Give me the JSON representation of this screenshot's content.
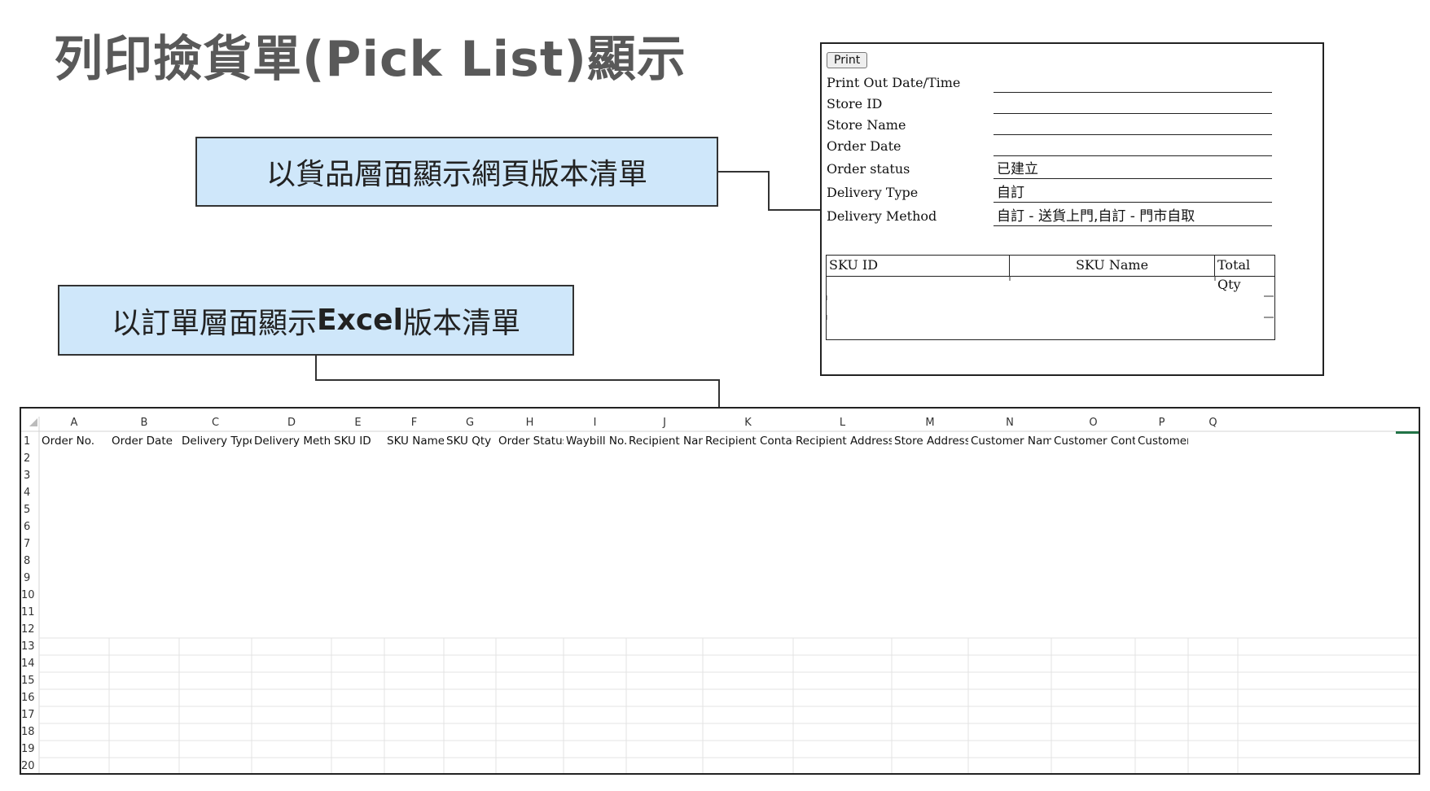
{
  "title": "列印撿貨單(Pick List)顯示",
  "callouts": {
    "web_prefix": "以貨品層面顯示網頁版本清單",
    "excel_prefix": "以訂單層面顯示",
    "excel_bold": "Excel",
    "excel_suffix": "版本清單"
  },
  "web_pick_list": {
    "print_button": "Print",
    "fields": [
      {
        "label": "Print Out Date/Time",
        "value": ""
      },
      {
        "label": "Store ID",
        "value": ""
      },
      {
        "label": "Store Name",
        "value": ""
      },
      {
        "label": "Order Date",
        "value": ""
      },
      {
        "label": "Order status",
        "value": "已建立"
      },
      {
        "label": "Delivery Type",
        "value": "自訂"
      },
      {
        "label": "Delivery Method",
        "value": "自訂 - 送貨上門,自訂 - 門市自取"
      }
    ],
    "table_headers": [
      "SKU ID",
      "SKU Name",
      "Total Qty"
    ]
  },
  "excel_sheet": {
    "column_letters": [
      "A",
      "B",
      "C",
      "D",
      "E",
      "F",
      "G",
      "H",
      "I",
      "J",
      "K",
      "L",
      "M",
      "N",
      "O",
      "P",
      "Q"
    ],
    "row_numbers": [
      "1",
      "2",
      "3",
      "4",
      "5",
      "6",
      "7",
      "8",
      "9",
      "10",
      "11",
      "12",
      "13",
      "14",
      "15",
      "16",
      "17",
      "18",
      "19",
      "20"
    ],
    "header_row": [
      "Order No.",
      "Order Date",
      "Delivery Type",
      "Delivery Method",
      "SKU ID",
      "SKU Name",
      "SKU Qty",
      "Order Status",
      "Waybill No.",
      "Recipient Name",
      "Recipient Contact",
      "Recipient Address",
      "Store Address",
      "Customer Name",
      "Customer Contact",
      "Customer Email",
      ""
    ]
  },
  "colors": {
    "title": "#595959",
    "callout_fill": "#cfe7fa",
    "excel_accent": "#217346"
  }
}
